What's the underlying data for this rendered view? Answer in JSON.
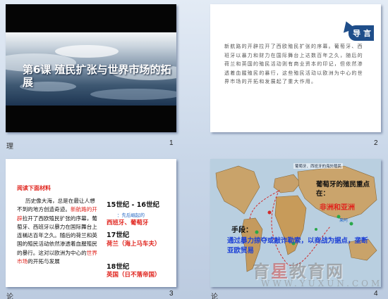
{
  "slides": [
    {
      "number": "1",
      "corner_glyph": "理",
      "title": "第6课 殖民扩张与世界市场的拓展"
    },
    {
      "number": "2",
      "badge": "导 言",
      "body": "新航路的开辟拉开了西欧殖民扩张的序幕。葡萄牙、西班牙以暴力和财力在国际舞台上达数百年之久，随后的荷兰和英国的殖民活动则有商业资本的印记，但依然渗透着血腥殖民的暴行，这些殖民活动以欧洲为中心的世界市场的开拓和发展起了重大作用。"
    },
    {
      "number": "3",
      "corner_glyph": "论",
      "heading": "阅读下面材料",
      "para_before": "历史像大海，总是在最让人想不到的地方创造奇迹。",
      "para_red1": "新航路的开辟",
      "para_mid": "拉开了西欧殖民扩张的序幕，葡萄牙、西班牙以暴力在国际舞台上连稱达百年之久。随后的荷兰和英国的殖民活动依然渗透着血腥殖民的暴行。这对以欧洲为中心的",
      "para_red2": "世界市场",
      "para_after": "的开拓与发展",
      "c1_label": "15世纪 - 16世纪",
      "c1_hint": "：先后崛起的",
      "c1_answer": "西班牙、葡萄牙",
      "c2_label": "17世纪",
      "c2_answer": "荷兰（海上马车夫）",
      "c3_label": "18世纪",
      "c3_answer": "英国（日不落帝国）"
    },
    {
      "number": "4",
      "corner_glyph": "论",
      "map_title": "葡萄牙、西班牙的海外殖民",
      "colony_label": "葡萄牙的殖民重点在：",
      "colony_value": "非洲和亚洲",
      "means_label": "手段：",
      "means_text": "通过暴力掠夺或敲诈勒索，以商战为据点，垄断亚欧贸易",
      "goa_label": "果阿"
    }
  ],
  "watermark": {
    "main_a": "育",
    "main_star": "星",
    "main_b": "教育网",
    "sub": "WWW.YUXUN.COM"
  },
  "colors": {
    "accent_red": "#e0231c",
    "accent_blue": "#1b3fd6",
    "badge_blue": "#1f4e8a"
  }
}
